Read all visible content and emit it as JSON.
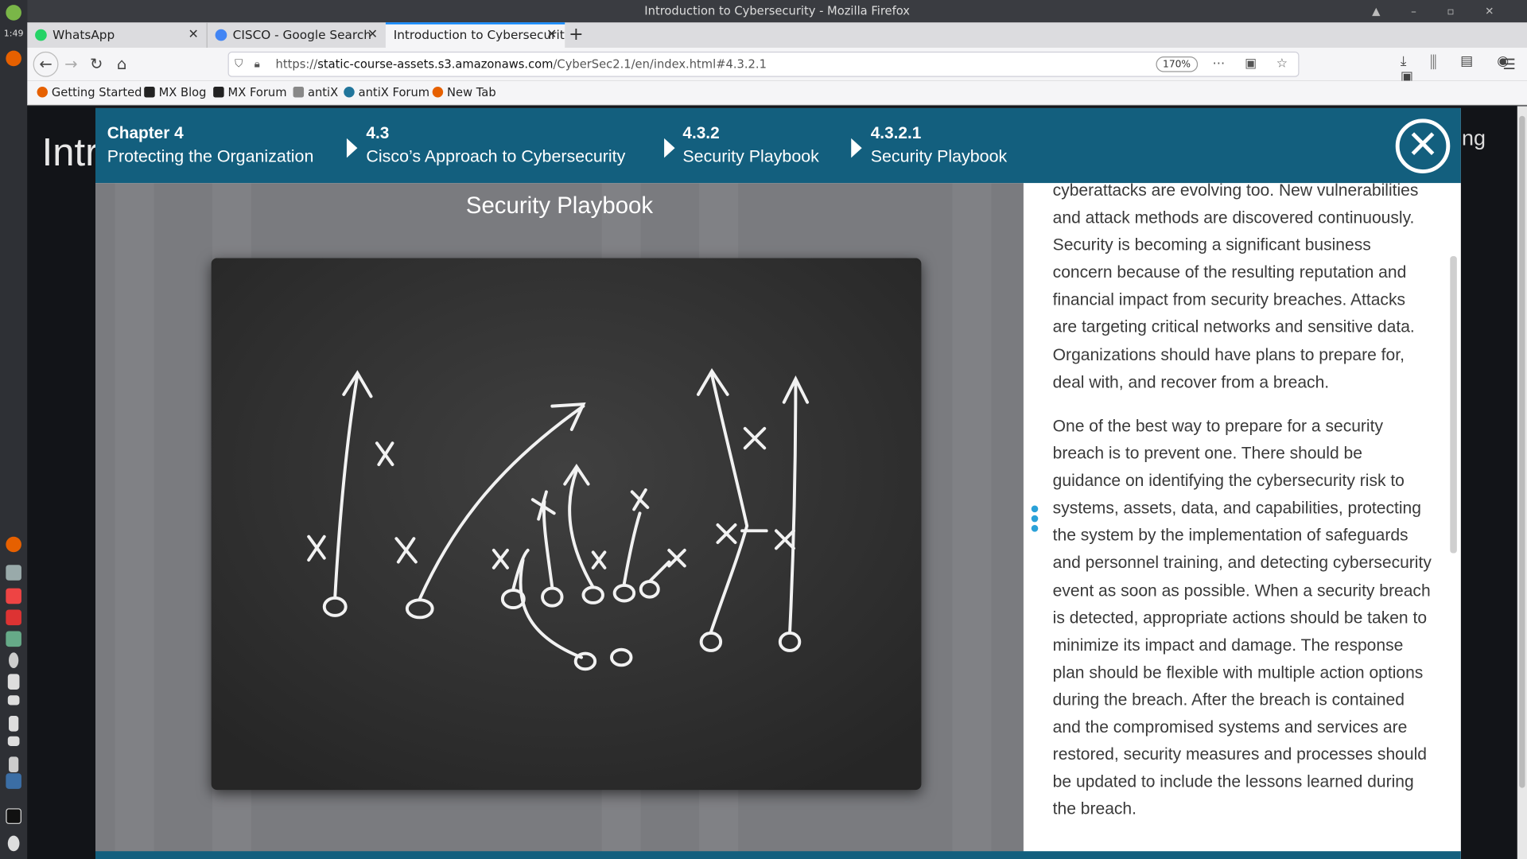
{
  "taskbar": {
    "clock": "1:49"
  },
  "window": {
    "title": "Introduction to Cybersecurity - Mozilla Firefox"
  },
  "tabs": [
    {
      "label": "WhatsApp",
      "color": "#25d366"
    },
    {
      "label": "CISCO - Google Search",
      "color": "#4285f4"
    },
    {
      "label": "Introduction to Cybersecurit",
      "color": "#999999"
    }
  ],
  "nav": {
    "url_prefix": "https://",
    "url_host": "static-course-assets.s3.amazonaws.com",
    "url_path": "/CyberSec2.1/en/index.html#4.3.2.1",
    "zoom": "170%"
  },
  "bookmarks": [
    {
      "label": "Getting Started",
      "color": "#e66000"
    },
    {
      "label": "MX Blog",
      "color": "#222222"
    },
    {
      "label": "MX Forum",
      "color": "#222222"
    },
    {
      "label": "antiX",
      "color": "#888888"
    },
    {
      "label": "antiX Forum",
      "color": "#21759b"
    },
    {
      "label": "New Tab",
      "color": "#e66000"
    }
  ],
  "background": {
    "title": "Intr",
    "right": "ng"
  },
  "breadcrumbs": [
    {
      "num": "Chapter 4",
      "title": "Protecting the Organization"
    },
    {
      "num": "4.3",
      "title": "Cisco’s Approach to Cybersecurity"
    },
    {
      "num": "4.3.2",
      "title": "Security Playbook"
    },
    {
      "num": "4.3.2.1",
      "title": "Security Playbook"
    }
  ],
  "content": {
    "panel_title": "Security Playbook",
    "para1": "cyberattacks are evolving too. New vulnerabilities and attack methods are discovered continuously. Security is becoming a significant business concern because of the resulting reputation and financial impact from security breaches. Attacks are targeting critical networks and sensitive data. Organizations should have plans to prepare for, deal with, and recover from a breach.",
    "para2": "One of the best way to prepare for a security breach is to prevent one. There should be guidance on identifying the cybersecurity risk to systems, assets, data, and capabilities, protecting the system by the implementation of safeguards and personnel training, and detecting cybersecurity event as soon as possible. When a security breach is detected, appropriate actions should be taken to minimize its impact and damage. The response plan should be flexible with multiple action options during the breach. After the breach is contained and the compromised systems and services are restored, security measures and processes should be updated to include the lessons learned during the breach."
  },
  "colors": {
    "accent": "#135f7e",
    "scroll_dots": "#2aa1d8"
  }
}
